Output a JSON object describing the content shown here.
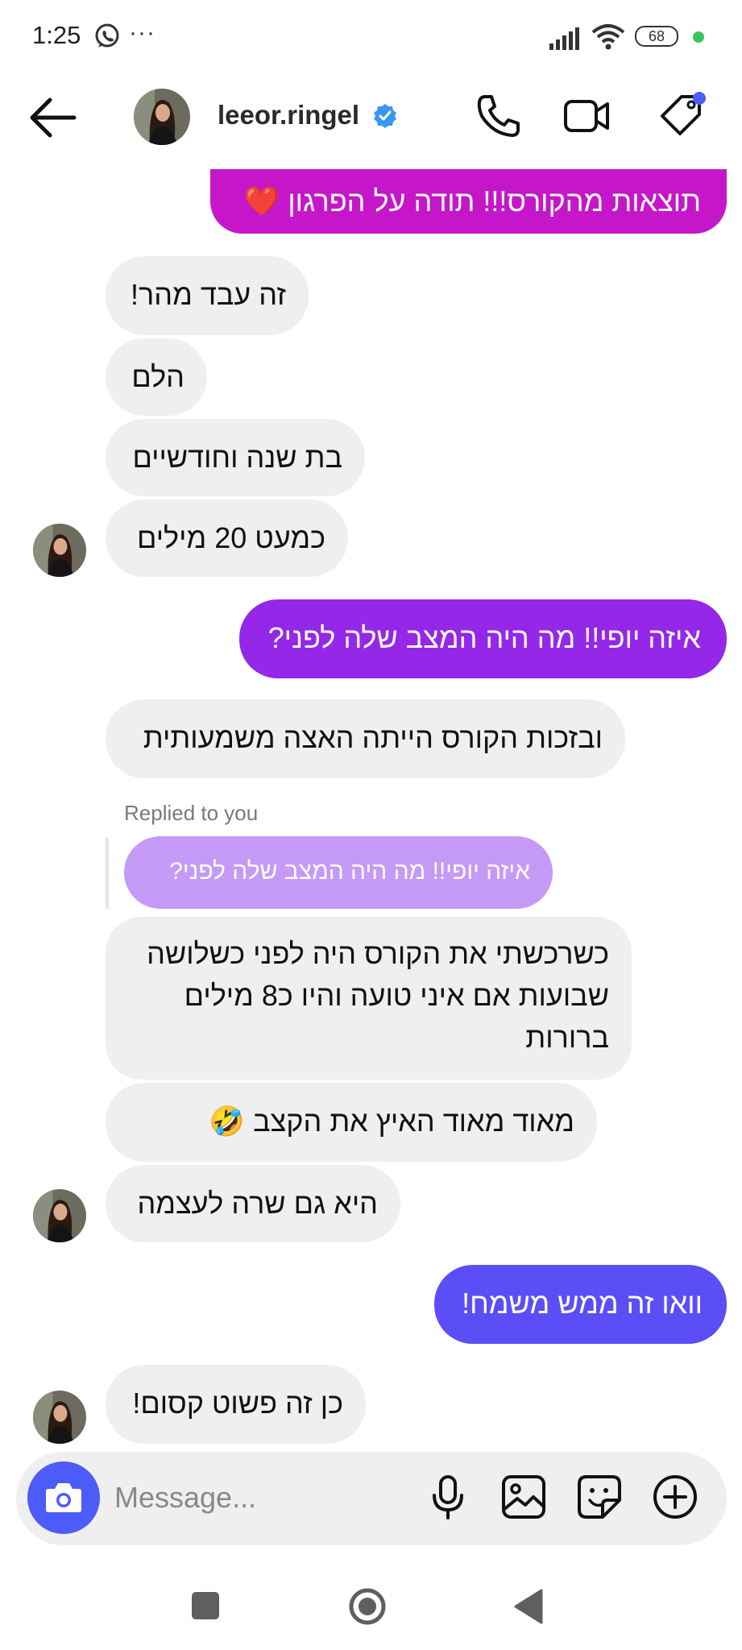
{
  "status_bar": {
    "time": "1:25",
    "dots": "···",
    "battery": "68"
  },
  "header": {
    "username": "leeor.ringel"
  },
  "messages": {
    "m0": "תוצאות מהקורס!!! תודה על הפרגון",
    "m0_emoji": "❤️",
    "m1": "זה עבד מהר!",
    "m2": "הלם",
    "m3": "בת שנה וחודשיים",
    "m4": "כמעט 20 מילים",
    "m5": "איזה יופי!! מה היה המצב שלה לפני?",
    "m6": "ובזכות הקורס הייתה האצה משמעותית",
    "replied_label": "Replied to you",
    "reply_quote": "איזה יופי!! מה היה המצב שלה לפני?",
    "m7_line1": "כשרכשתי את הקורס היה לפני כשלושה",
    "m7_line2": "שבועות אם איני טועה והיו כ8 מילים",
    "m7_line3": "ברורות",
    "m8": "מאוד מאוד האיץ את הקצב",
    "m8_emoji": "🤣",
    "m9": "היא גם שרה לעצמה",
    "m10": "וואו זה ממש משמח!",
    "m11": "כן זה פשוט קסום!"
  },
  "composer": {
    "placeholder": "Message..."
  },
  "colors": {
    "magenta": "#c517c9",
    "purple": "#9427e8",
    "indigo": "#5b4ef6",
    "reply_quote": "#c59af7",
    "camera": "#4d5bf9",
    "verified": "#3897f0",
    "online_dot": "#35c759"
  },
  "icons": [
    "whatsapp-icon",
    "more-dots-icon",
    "signal-icon",
    "wifi-icon",
    "battery-icon",
    "back-arrow-icon",
    "verified-badge-icon",
    "phone-icon",
    "video-icon",
    "tag-icon",
    "camera-icon",
    "microphone-icon",
    "gallery-icon",
    "sticker-icon",
    "plus-circle-icon",
    "nav-recents-icon",
    "nav-home-icon",
    "nav-back-icon"
  ]
}
